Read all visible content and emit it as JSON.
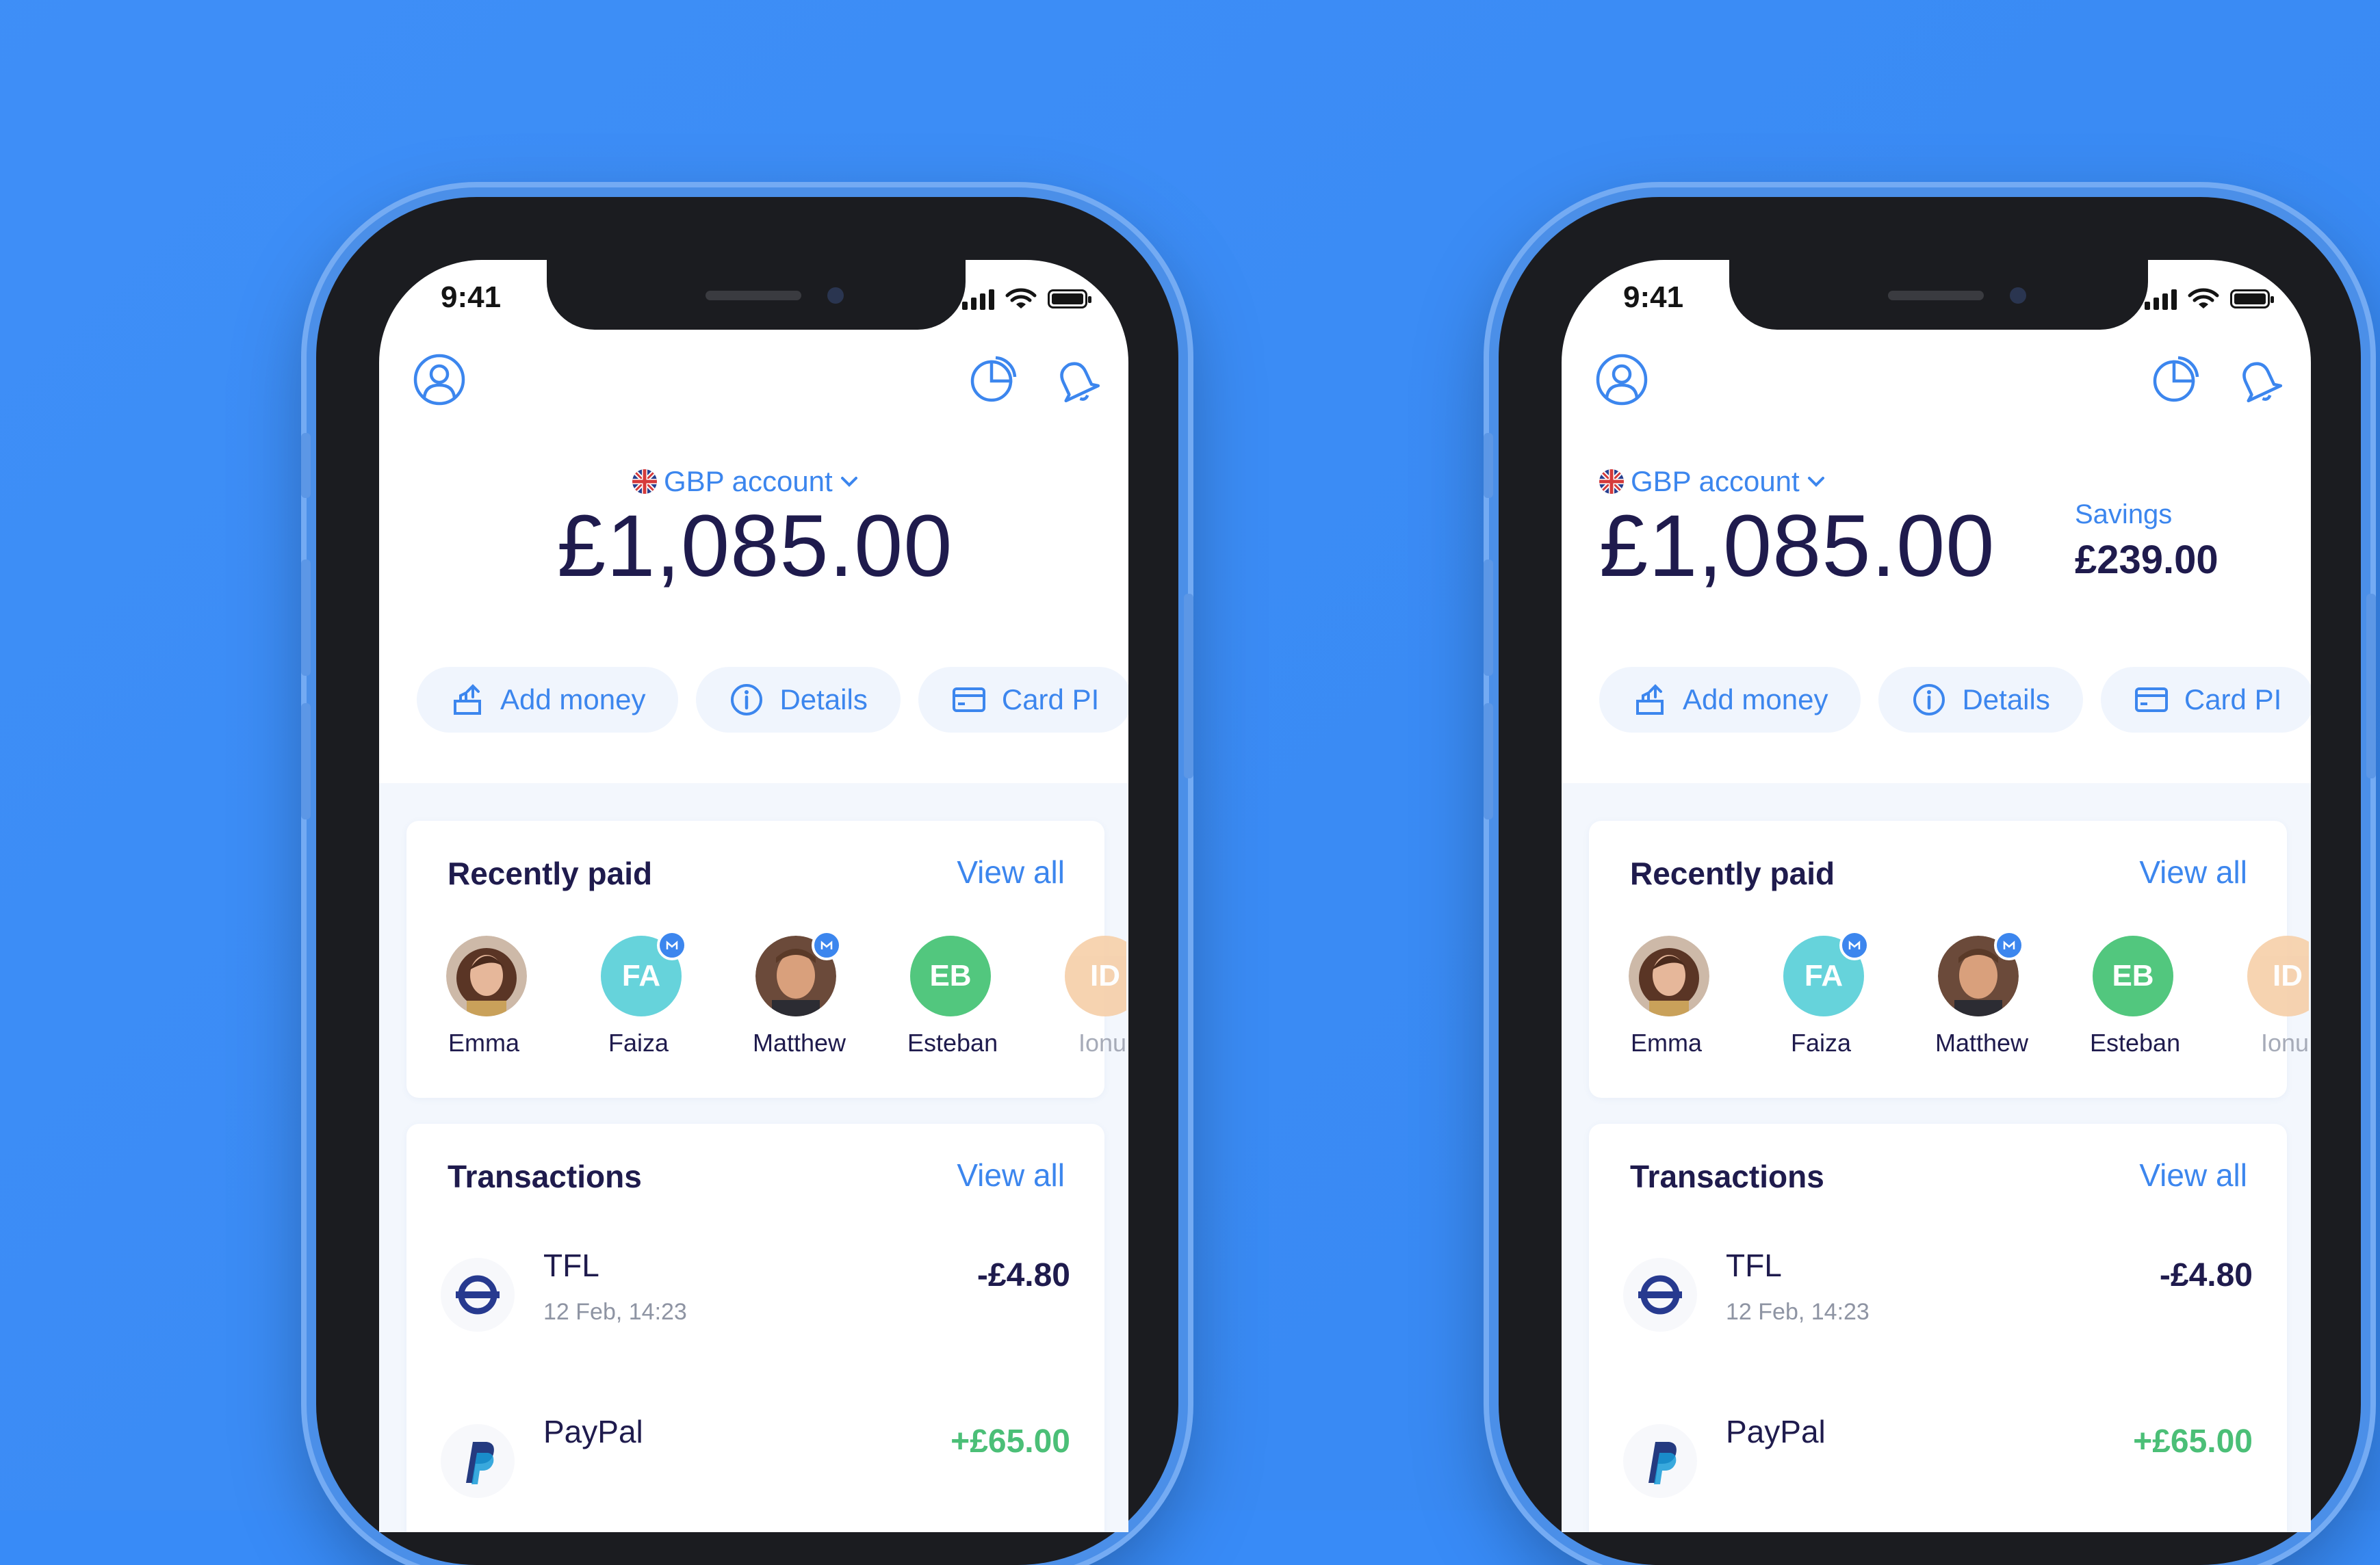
{
  "colors": {
    "background": "#388bf7",
    "accent": "#3c86ee",
    "text_primary": "#1f1b4d",
    "positive": "#4bbf77"
  },
  "left_phone": {
    "status_bar": {
      "time": "9:41"
    },
    "header_icons": [
      "profile-icon",
      "stats-icon",
      "bell-icon"
    ],
    "account": {
      "selector_label": "GBP account",
      "balance": "£1,085.00"
    },
    "actions": [
      {
        "label": "Add money",
        "icon": "add-money-icon"
      },
      {
        "label": "Details",
        "icon": "info-icon"
      },
      {
        "label": "Card PI",
        "icon": "card-icon"
      }
    ],
    "recently_paid": {
      "title": "Recently paid",
      "view_all": "View all",
      "contacts": [
        {
          "name": "Emma",
          "initials": ""
        },
        {
          "name": "Faiza",
          "initials": "FA"
        },
        {
          "name": "Matthew",
          "initials": ""
        },
        {
          "name": "Esteban",
          "initials": "EB"
        },
        {
          "name": "Ionu",
          "initials": "ID"
        }
      ]
    },
    "transactions": {
      "title": "Transactions",
      "view_all": "View all",
      "items": [
        {
          "name": "TFL",
          "date": "12 Feb, 14:23",
          "amount": "-£4.80"
        },
        {
          "name": "PayPal",
          "date": "",
          "amount": "+£65.00"
        }
      ]
    }
  },
  "right_phone": {
    "status_bar": {
      "time": "9:41"
    },
    "header_icons": [
      "profile-icon",
      "stats-icon",
      "bell-icon"
    ],
    "account": {
      "selector_label": "GBP account",
      "balance": "£1,085.00"
    },
    "savings": {
      "label": "Savings",
      "value": "£239.00"
    },
    "actions": [
      {
        "label": "Add money",
        "icon": "add-money-icon"
      },
      {
        "label": "Details",
        "icon": "info-icon"
      },
      {
        "label": "Card PI",
        "icon": "card-icon"
      }
    ],
    "recently_paid": {
      "title": "Recently paid",
      "view_all": "View all",
      "contacts": [
        {
          "name": "Emma",
          "initials": ""
        },
        {
          "name": "Faiza",
          "initials": "FA"
        },
        {
          "name": "Matthew",
          "initials": ""
        },
        {
          "name": "Esteban",
          "initials": "EB"
        },
        {
          "name": "Ionu",
          "initials": "ID"
        }
      ]
    },
    "transactions": {
      "title": "Transactions",
      "view_all": "View all",
      "items": [
        {
          "name": "TFL",
          "date": "12 Feb, 14:23",
          "amount": "-£4.80"
        },
        {
          "name": "PayPal",
          "date": "",
          "amount": "+£65.00"
        }
      ]
    }
  }
}
